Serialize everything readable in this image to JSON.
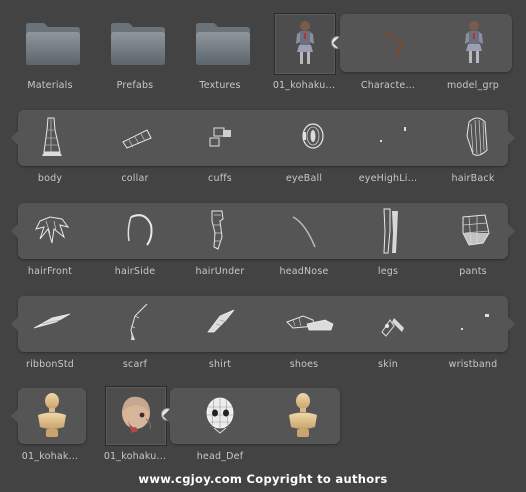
{
  "folders": [
    {
      "label": "Materials",
      "icon": "folder-icon"
    },
    {
      "label": "Prefabs",
      "icon": "folder-icon"
    },
    {
      "label": "Textures",
      "icon": "folder-icon"
    }
  ],
  "row1_assets": [
    {
      "label": "01_kohaku...",
      "icon": "character-model-icon"
    },
    {
      "label": "Characte...",
      "icon": "animation-curve-icon"
    },
    {
      "label": "model_grp",
      "icon": "character-model-icon"
    }
  ],
  "row2_assets": [
    {
      "label": "body",
      "icon": "mesh-body-icon"
    },
    {
      "label": "collar",
      "icon": "mesh-collar-icon"
    },
    {
      "label": "cuffs",
      "icon": "mesh-cuffs-icon"
    },
    {
      "label": "eyeBall",
      "icon": "mesh-eyeball-icon"
    },
    {
      "label": "eyeHighLi...",
      "icon": "mesh-eyehighlight-icon"
    },
    {
      "label": "hairBack",
      "icon": "mesh-hairback-icon"
    }
  ],
  "row3_assets": [
    {
      "label": "hairFront",
      "icon": "mesh-hairfront-icon"
    },
    {
      "label": "hairSide",
      "icon": "mesh-hairside-icon"
    },
    {
      "label": "hairUnder",
      "icon": "mesh-hairunder-icon"
    },
    {
      "label": "headNose",
      "icon": "mesh-headnose-icon"
    },
    {
      "label": "legs",
      "icon": "mesh-legs-icon"
    },
    {
      "label": "pants",
      "icon": "mesh-pants-icon"
    }
  ],
  "row4_assets": [
    {
      "label": "ribbonStd",
      "icon": "mesh-ribbon-icon"
    },
    {
      "label": "scarf",
      "icon": "mesh-scarf-icon"
    },
    {
      "label": "shirt",
      "icon": "mesh-shirt-icon"
    },
    {
      "label": "shoes",
      "icon": "mesh-shoes-icon"
    },
    {
      "label": "skin",
      "icon": "mesh-skin-icon"
    },
    {
      "label": "wristband",
      "icon": "mesh-wristband-icon"
    }
  ],
  "row5_assets": [
    {
      "label": "01_kohak...",
      "icon": "avatar-mannequin-icon"
    },
    {
      "label": "01_kohaku...",
      "icon": "head-model-icon"
    },
    {
      "label": "head_Def",
      "icon": "head-wireframe-icon"
    },
    {
      "label": "",
      "icon": "avatar-mannequin-icon"
    }
  ],
  "footer": {
    "text": "www.cgjoy.com Copyright to authors"
  },
  "colors": {
    "background": "#434343",
    "strip": "#555555",
    "label": "#c8c8c8",
    "footer": "#ffffff"
  }
}
